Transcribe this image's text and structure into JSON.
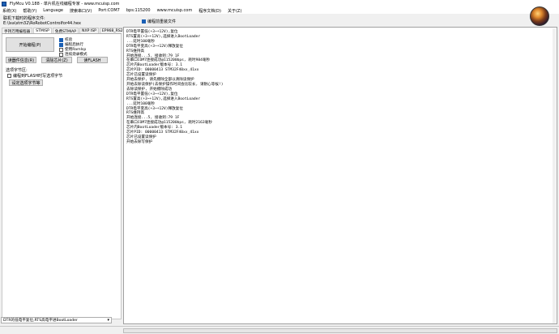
{
  "window": {
    "title": "FlyMcu V0.188 - 单片机在线编程专家 - www.mcuisp.com"
  },
  "menu": [
    "系统(X)",
    "帮助(Y)",
    "Language",
    "搜索串口(V)",
    "Port:COM7",
    "bps:115200",
    "www.mcuisp.com",
    "程序文档(D)",
    "关于(Z)"
  ],
  "header": {
    "path_label": "联机下载时的程序文件:",
    "path_value": "E:\\lxa\\stm32\\RoRobotControlfor44.hex",
    "reload_label": "编程前重装文件",
    "reload_checked": true
  },
  "tabs": [
    "手持万用编程器",
    "STMISP",
    "免费STMIAP",
    "NXP ISP",
    "EP968_RS232"
  ],
  "stmisp": {
    "start_button": "开始编程(P)",
    "options": [
      {
        "label": "校验",
        "checked": true
      },
      {
        "label": "编程后执行",
        "checked": true
      },
      {
        "label": "使用RamIsp",
        "checked": false
      },
      {
        "label": "连续烧录模式",
        "checked": false
      }
    ],
    "read_info_button": "读器件信息(R)",
    "erase_button": "清除芯片(Z)",
    "read_flash_button": "读FLASH",
    "option_group_label": "选项字节区:",
    "write_option_label": "编程到FLASH时写选项字节",
    "write_option_checked": false,
    "set_option_button": "设定选项字节等"
  },
  "dtr_select": {
    "value": "DTR的低电平复位,RTS高电平进BootLoader"
  },
  "log": [
    "DTR电平置低(+3~+12V),复位",
    "RTS置高(+3~+12V),选择进入BootLoader",
    "...延时100毫秒",
    "DTR电平变高(+3~+12V)释放复位",
    "RTS维持高",
    "开始连接...5, 接收到:79 1F",
    "在串口COM7连接成功@115200bps, 耗时984毫秒",
    "芯片内BootLoader版本号: 3.1",
    "芯片PID: 00000413  STM32F40xx_41xx",
    "芯片已设置读保护",
    "开始去保护, 请先擦除全部以清除读保护",
    "开始去除读保护(去保护操作时间会比较长, 请耐心等候!)",
    "去除读保护, 开始擦除成功",
    "DTR电平置低(+3~+12V),复位",
    "RTS置高(+3~+12V),选择进入BootLoader",
    "...延时100毫秒",
    "DTR电平变高(+3~+12V)释放复位",
    "RTS维持高",
    "开始连接...5, 接收到:79 1F",
    "在串口COM7连接成功@115200bps, 耗时2163毫秒",
    "芯片内BootLoader版本号: 3.1",
    "芯片PID: 00000413  STM32F40xx_41xx",
    "芯片已设置读保护",
    "开始去除写保护"
  ],
  "progress": {
    "percent": 0
  }
}
